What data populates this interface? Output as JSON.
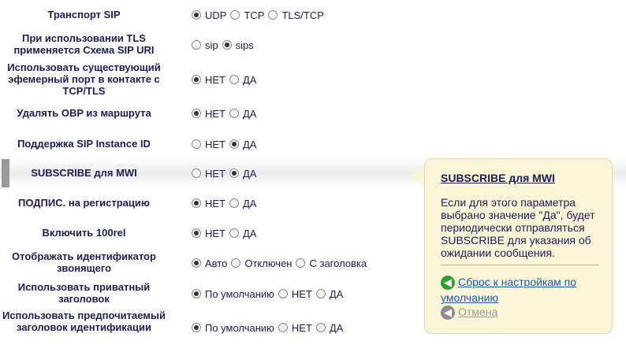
{
  "rows": [
    {
      "label": "Транспорт SIP",
      "options": [
        {
          "label": "UDP",
          "on": true
        },
        {
          "label": "TCP",
          "on": false
        },
        {
          "label": "TLS/TCP",
          "on": false
        }
      ]
    },
    {
      "label": "При использовании TLS применяется Схема SIP URI",
      "options": [
        {
          "label": "sip",
          "on": false
        },
        {
          "label": "sips",
          "on": true
        }
      ]
    },
    {
      "label": "Использовать существующий эфемерный порт в контакте с TCP/TLS",
      "options": [
        {
          "label": "НЕТ",
          "on": true
        },
        {
          "label": "ДА",
          "on": false
        }
      ]
    },
    {
      "label": "Удалять OBP из маршрута",
      "options": [
        {
          "label": "НЕТ",
          "on": true
        },
        {
          "label": "ДА",
          "on": false
        }
      ]
    },
    {
      "label": "Поддержка SIP Instance ID",
      "options": [
        {
          "label": "НЕТ",
          "on": false
        },
        {
          "label": "ДА",
          "on": true
        }
      ]
    },
    {
      "label": "SUBSCRIBE для MWI",
      "options": [
        {
          "label": "НЕТ",
          "on": false
        },
        {
          "label": "ДА",
          "on": true
        }
      ]
    },
    {
      "label": "ПОДПИС. на регистрацию",
      "options": [
        {
          "label": "НЕТ",
          "on": true
        },
        {
          "label": "ДА",
          "on": false
        }
      ]
    },
    {
      "label": "Включить 100rel",
      "options": [
        {
          "label": "НЕТ",
          "on": true
        },
        {
          "label": "ДА",
          "on": false
        }
      ]
    },
    {
      "label": "Отображать идентификатор звонящего",
      "options": [
        {
          "label": "Авто",
          "on": true
        },
        {
          "label": "Отключен",
          "on": false
        },
        {
          "label": "С заголовка",
          "on": false
        }
      ]
    },
    {
      "label": "Использовать приватный заголовок",
      "options": [
        {
          "label": "По умолчанию",
          "on": true
        },
        {
          "label": "НЕТ",
          "on": false
        },
        {
          "label": "ДА",
          "on": false
        }
      ]
    },
    {
      "label": "Использовать предпочитаемый заголовок идентификации",
      "options": [
        {
          "label": "По умолчанию",
          "on": true
        },
        {
          "label": "НЕТ",
          "on": false
        },
        {
          "label": "ДА",
          "on": false
        }
      ]
    }
  ],
  "tooltip": {
    "title": "SUBSCRIBE для MWI",
    "body": "Если для этого параметра выбрано значение \"Да\", будет периодически отправляться SUBSCRIBE для указания об ожидании сообщения.",
    "reset_link": "Сброс к настройкам по умолчанию",
    "cancel_link": "Отмена",
    "reset_icon": "arrow-left-green-icon",
    "cancel_icon": "arrow-left-gray-icon"
  }
}
